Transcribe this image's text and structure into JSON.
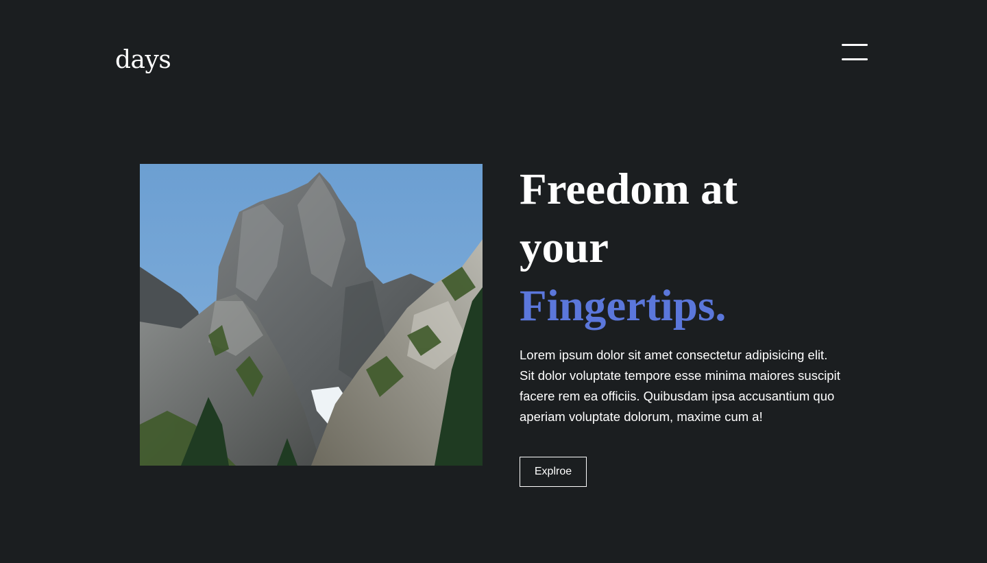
{
  "header": {
    "logo": "days",
    "menu_icon": "hamburger-menu-icon"
  },
  "hero": {
    "image_subject": "rocky mountain peak under blue sky",
    "headline_line1": "Freedom at",
    "headline_line2": "your",
    "headline_line3": "Fingertips.",
    "description": "Lorem ipsum dolor sit amet consectetur adipisicing elit. Sit dolor voluptate tempore esse minima maiores suscipit facere rem ea officiis. Quibusdam ipsa accusantium quo aperiam voluptate dolorum, maxime cum a!",
    "button_label": "Explroe"
  },
  "colors": {
    "background": "#1b1e20",
    "text": "#ffffff",
    "accent": "#5b77db"
  }
}
